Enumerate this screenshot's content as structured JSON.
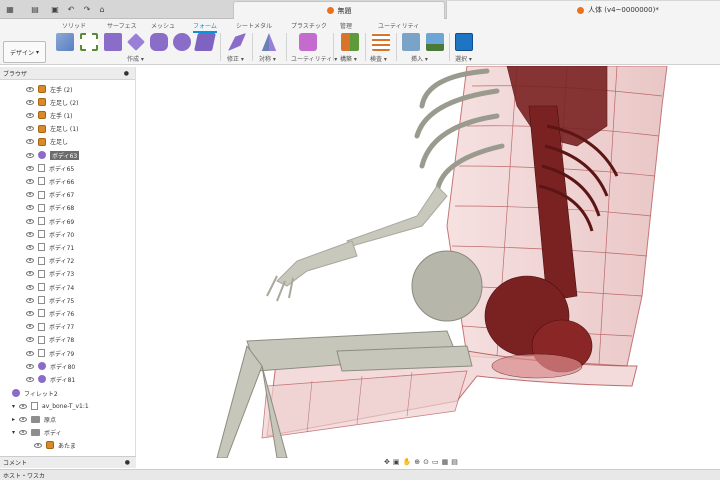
{
  "titlebar": {
    "document_tab": "無題",
    "second_doc": "人体 (v4~0000000)*"
  },
  "toolbar": {
    "workspace": "デザイン",
    "ribbon_tabs": [
      "ソリッド",
      "サーフェス",
      "メッシュ",
      "フォーム",
      "シートメタル",
      "プラスチック",
      "管理",
      "ユーティリティ"
    ],
    "active_tab": "フォーム",
    "groups": [
      "作成",
      "修正",
      "対称",
      "ユーティリティ",
      "構築",
      "検査",
      "挿入",
      "選択"
    ]
  },
  "browser": {
    "header": "ブラウザ",
    "rows": [
      {
        "label": "左手 (2)",
        "icon": "body"
      },
      {
        "label": "左足し (2)",
        "icon": "body"
      },
      {
        "label": "左手 (1)",
        "icon": "body"
      },
      {
        "label": "左足し (1)",
        "icon": "body"
      },
      {
        "label": "左足し",
        "icon": "body"
      },
      {
        "label": "ボディ63",
        "icon": "purple",
        "selected": true
      },
      {
        "label": "ボディ65",
        "icon": "doc"
      },
      {
        "label": "ボディ66",
        "icon": "doc"
      },
      {
        "label": "ボディ67",
        "icon": "doc"
      },
      {
        "label": "ボディ68",
        "icon": "doc"
      },
      {
        "label": "ボディ69",
        "icon": "doc"
      },
      {
        "label": "ボディ70",
        "icon": "doc"
      },
      {
        "label": "ボディ71",
        "icon": "doc"
      },
      {
        "label": "ボディ72",
        "icon": "doc"
      },
      {
        "label": "ボディ73",
        "icon": "doc"
      },
      {
        "label": "ボディ74",
        "icon": "doc"
      },
      {
        "label": "ボディ75",
        "icon": "doc"
      },
      {
        "label": "ボディ76",
        "icon": "doc"
      },
      {
        "label": "ボディ77",
        "icon": "doc"
      },
      {
        "label": "ボディ78",
        "icon": "doc"
      },
      {
        "label": "ボディ79",
        "icon": "doc"
      },
      {
        "label": "ボディ80",
        "icon": "purple"
      },
      {
        "label": "ボディ81",
        "icon": "purple"
      }
    ],
    "extra": [
      {
        "label": "フィレット2"
      },
      {
        "label": "av_bone-T_v1:1"
      },
      {
        "label": "原点"
      },
      {
        "label": "ボディ"
      },
      {
        "label": "あたま"
      }
    ]
  },
  "comments": "コメント",
  "status": "ホスト・ワスカ"
}
